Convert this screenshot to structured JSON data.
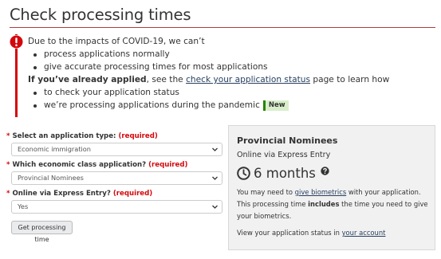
{
  "page": {
    "title": "Check processing times"
  },
  "alert": {
    "icon": "alert-exclamation-icon",
    "accent_color": "#d3080c",
    "intro": "Due to the impacts of COVID-19, we can’t",
    "items": [
      "process applications normally",
      "give accurate processing times for most applications"
    ],
    "applied_strong": "If you’ve already applied",
    "applied_pre_link": ", see the ",
    "applied_link": "check your application status",
    "applied_post_link": " page to learn how",
    "items2": [
      "to check your application status",
      "we’re processing applications during the pandemic"
    ],
    "new_badge": "New"
  },
  "form": {
    "fields": [
      {
        "star": "*",
        "label": " Select an application type: ",
        "required": "(required)",
        "value": "Economic immigration"
      },
      {
        "star": "*",
        "label": " Which economic class application? ",
        "required": "(required)",
        "value": "Provincial Nominees"
      },
      {
        "star": "*",
        "label": " Online via Express Entry? ",
        "required": "(required)",
        "value": "Yes"
      }
    ],
    "submit_label": "Get processing time"
  },
  "result": {
    "title": "Provincial Nominees",
    "subtitle": "Online via Express Entry",
    "time_value": "6 months",
    "time_icon": "clock-icon",
    "help_icon": "question-circle-icon",
    "body_pre": "You may need to ",
    "body_link": "give biometrics",
    "body_mid": " with your application. This processing time ",
    "body_strong": "includes",
    "body_post": " the time you need to give your biometrics.",
    "foot_pre": "View your application status in ",
    "foot_link": "your account"
  }
}
